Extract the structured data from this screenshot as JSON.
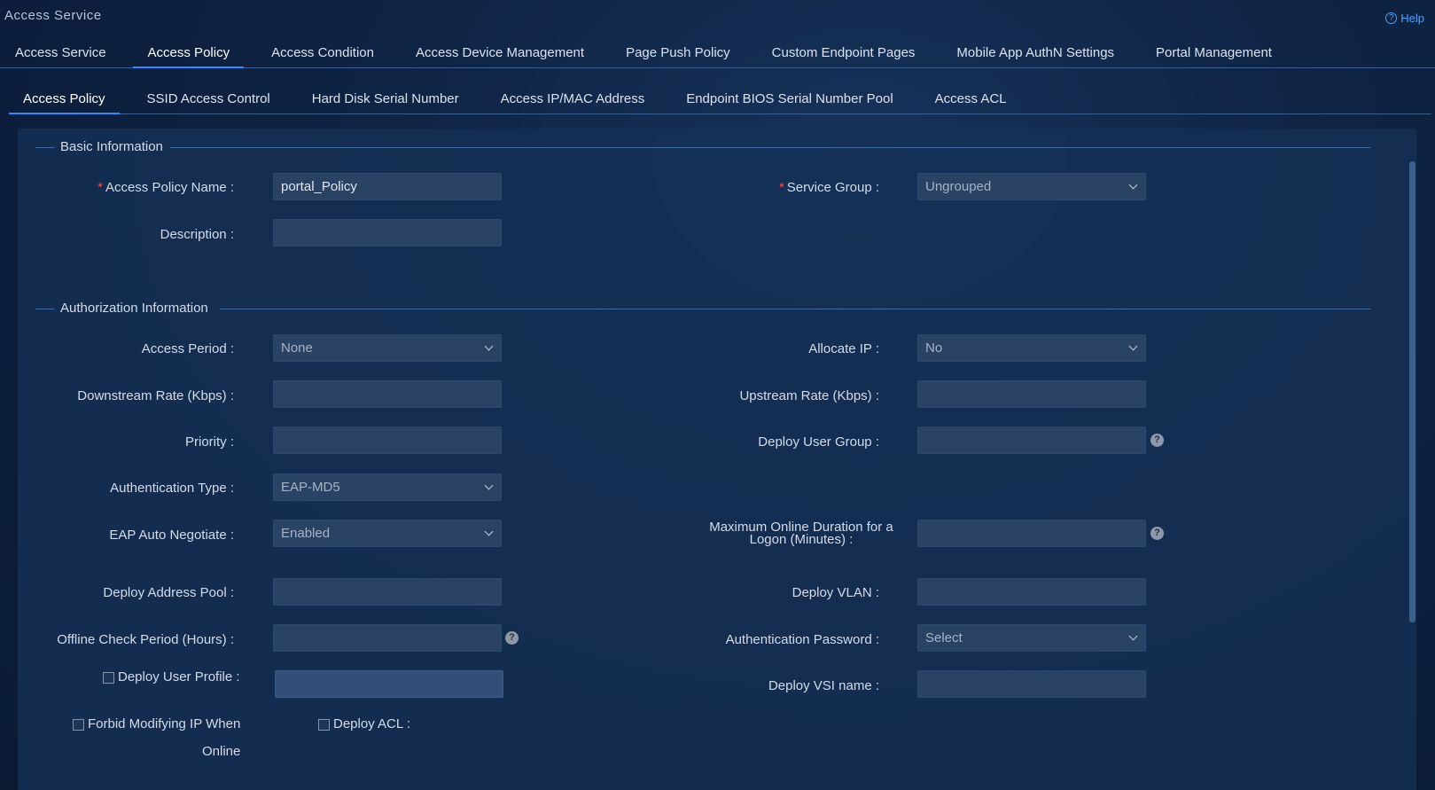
{
  "app": {
    "title": "Access Service",
    "help": "Help"
  },
  "top_tabs": [
    "Access Service",
    "Access Policy",
    "Access Condition",
    "Access Device Management",
    "Page Push Policy",
    "Custom Endpoint Pages",
    "Mobile App AuthN Settings",
    "Portal Management"
  ],
  "sub_tabs": [
    "Access Policy",
    "SSID Access Control",
    "Hard Disk Serial Number",
    "Access IP/MAC Address",
    "Endpoint BIOS Serial Number Pool",
    "Access ACL"
  ],
  "basic": {
    "title": "Basic Information",
    "policy_name_label": "Access Policy Name :",
    "policy_name_value": "portal_Policy",
    "service_group_label": "Service Group :",
    "service_group_value": "Ungrouped",
    "description_label": "Description :"
  },
  "auth": {
    "title": "Authorization Information",
    "access_period_label": "Access Period :",
    "access_period_value": "None",
    "allocate_ip_label": "Allocate IP :",
    "allocate_ip_value": "No",
    "downstream_label": "Downstream Rate (Kbps) :",
    "upstream_label": "Upstream Rate (Kbps) :",
    "priority_label": "Priority :",
    "deploy_user_group_label": "Deploy User Group :",
    "auth_type_label": "Authentication Type :",
    "auth_type_value": "EAP-MD5",
    "eap_label": "EAP Auto Negotiate :",
    "eap_value": "Enabled",
    "max_online_label": "Maximum Online Duration for a Logon (Minutes) :",
    "address_pool_label": "Deploy Address Pool :",
    "vlan_label": "Deploy VLAN :",
    "offline_label": "Offline Check Period (Hours) :",
    "auth_password_label": "Authentication Password :",
    "auth_password_value": "Select",
    "user_profile_label": "Deploy User Profile :",
    "vsi_label": "Deploy VSI name :",
    "forbid_ip_label_1": "Forbid Modifying IP When",
    "forbid_ip_label_2": "Online",
    "deploy_acl_label": "Deploy ACL :",
    "help_glyph": "?"
  }
}
